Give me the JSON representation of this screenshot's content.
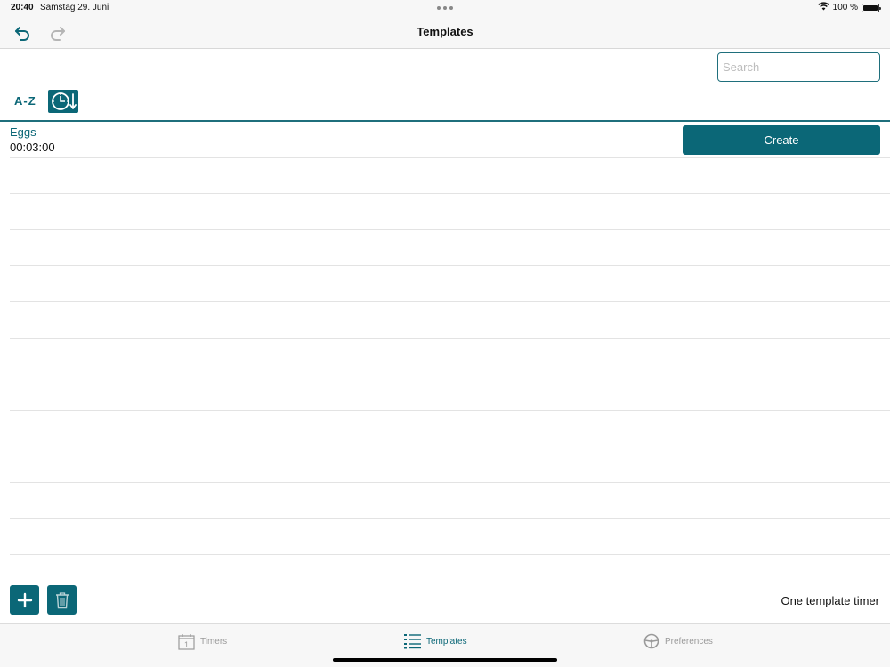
{
  "status_bar": {
    "time": "20:40",
    "date": "Samstag 29. Juni",
    "battery": "100 %"
  },
  "nav": {
    "title": "Templates",
    "undo_icon": "undo-arrow-icon",
    "redo_icon": "redo-arrow-icon"
  },
  "search": {
    "placeholder": "Search",
    "value": ""
  },
  "sort": {
    "az_label": "A-Z",
    "time_sort_icon": "clock-sort-descending-icon"
  },
  "templates": [
    {
      "name": "Eggs",
      "duration": "00:03:00",
      "action_label": "Create"
    }
  ],
  "empty_rows": 11,
  "footer": {
    "add_icon": "plus-icon",
    "delete_icon": "trash-icon",
    "count_text": "One template timer"
  },
  "tabs": [
    {
      "label": "Timers",
      "icon": "calendar-icon",
      "active": false
    },
    {
      "label": "Templates",
      "icon": "list-icon",
      "active": true
    },
    {
      "label": "Preferences",
      "icon": "steering-wheel-icon",
      "active": false
    }
  ],
  "colors": {
    "accent": "#0b6777",
    "bar_background": "#f7f7f7",
    "inactive": "#9a9a9a"
  }
}
